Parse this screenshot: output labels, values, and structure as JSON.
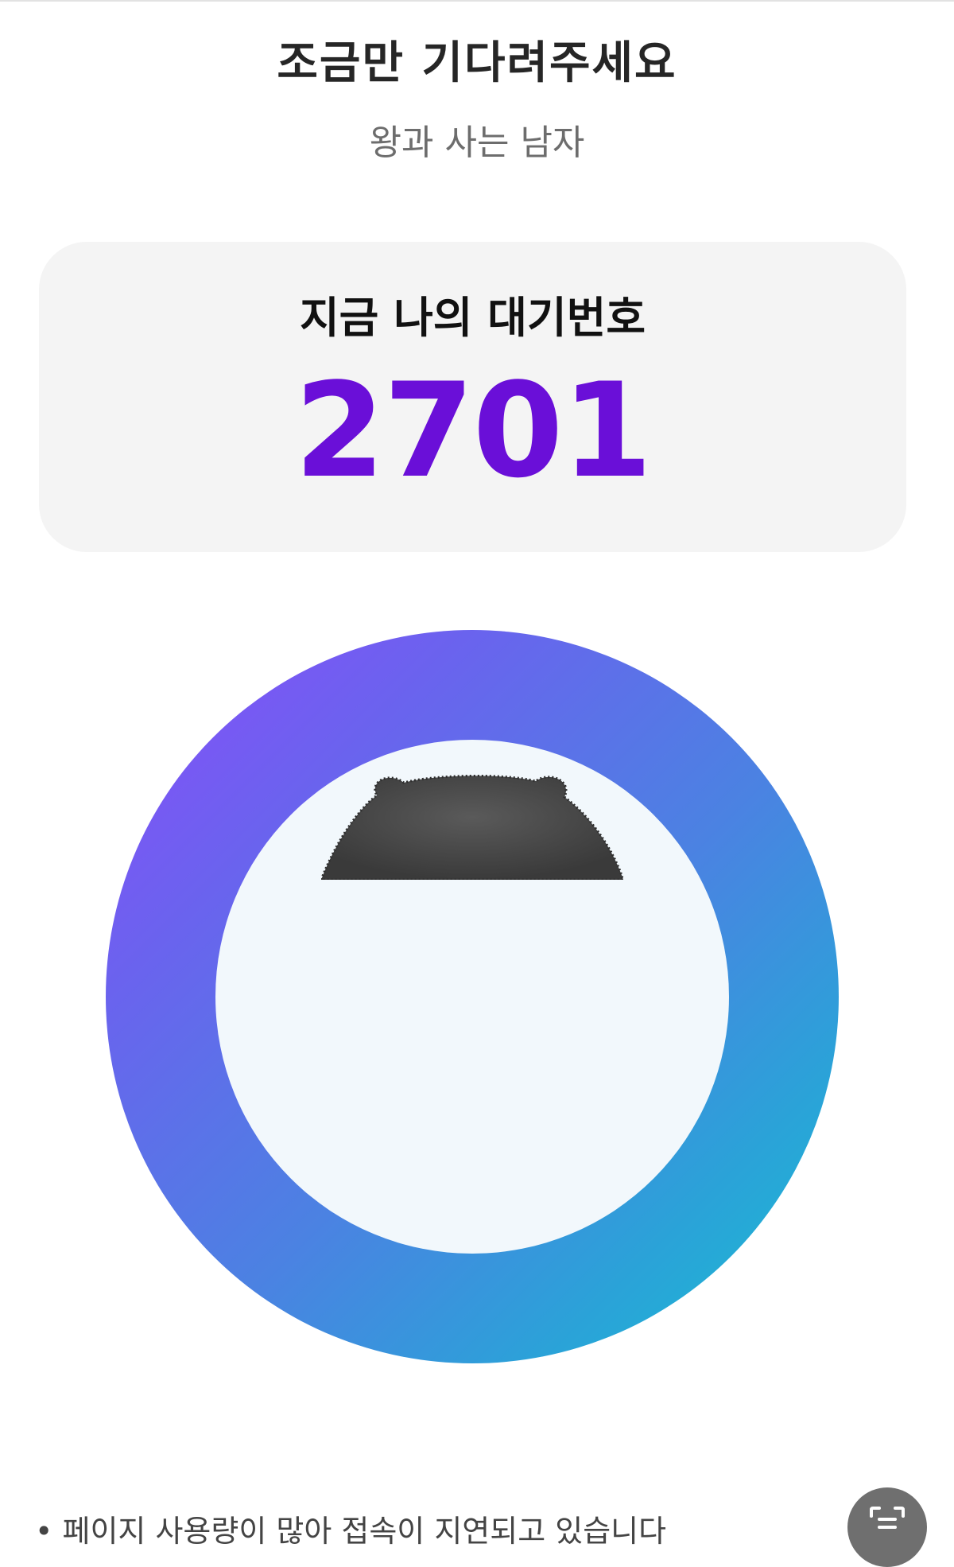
{
  "header": {
    "title": "조금만 기다려주세요",
    "subtitle": "왕과 사는 남자"
  },
  "queue": {
    "label": "지금 나의 대기번호",
    "number": "2701"
  },
  "notice": {
    "text": "• 페이지 사용량이 많아 접속이 지연되고 있습니다"
  },
  "icons": {
    "mascot": "bear-mascot-icon",
    "scan": "scan-text-icon"
  },
  "colors": {
    "accent": "#6a0fd8",
    "ring_start": "#8a4cfb",
    "ring_end": "#18bfd2",
    "card_bg": "#f4f4f4"
  }
}
